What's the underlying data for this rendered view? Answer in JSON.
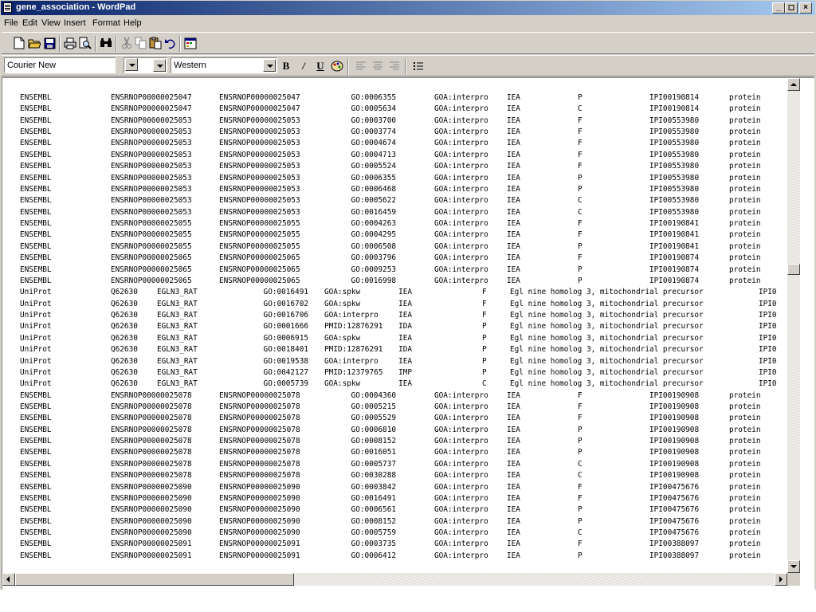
{
  "window": {
    "title": "gene_association - WordPad"
  },
  "menu": [
    "File",
    "Edit",
    "View",
    "Insert",
    "Format",
    "Help"
  ],
  "format_bar": {
    "font": "Courier New",
    "size": "8",
    "script": "Western"
  },
  "document": {
    "lines": [
      [
        "ENSEMBL",
        "ENSRNOP00000025047",
        "ENSRNOP00000025047",
        "GO:0006355",
        "GOA:interpro",
        "IEA",
        "P",
        "IPI00190814",
        "protein"
      ],
      [
        "ENSEMBL",
        "ENSRNOP00000025047",
        "ENSRNOP00000025047",
        "GO:0005634",
        "GOA:interpro",
        "IEA",
        "C",
        "IPI00190814",
        "protein"
      ],
      [
        "ENSEMBL",
        "ENSRNOP00000025053",
        "ENSRNOP00000025053",
        "GO:0003700",
        "GOA:interpro",
        "IEA",
        "F",
        "IPI00553980",
        "protein"
      ],
      [
        "ENSEMBL",
        "ENSRNOP00000025053",
        "ENSRNOP00000025053",
        "GO:0003774",
        "GOA:interpro",
        "IEA",
        "F",
        "IPI00553980",
        "protein"
      ],
      [
        "ENSEMBL",
        "ENSRNOP00000025053",
        "ENSRNOP00000025053",
        "GO:0004674",
        "GOA:interpro",
        "IEA",
        "F",
        "IPI00553980",
        "protein"
      ],
      [
        "ENSEMBL",
        "ENSRNOP00000025053",
        "ENSRNOP00000025053",
        "GO:0004713",
        "GOA:interpro",
        "IEA",
        "F",
        "IPI00553980",
        "protein"
      ],
      [
        "ENSEMBL",
        "ENSRNOP00000025053",
        "ENSRNOP00000025053",
        "GO:0005524",
        "GOA:interpro",
        "IEA",
        "F",
        "IPI00553980",
        "protein"
      ],
      [
        "ENSEMBL",
        "ENSRNOP00000025053",
        "ENSRNOP00000025053",
        "GO:0006355",
        "GOA:interpro",
        "IEA",
        "P",
        "IPI00553980",
        "protein"
      ],
      [
        "ENSEMBL",
        "ENSRNOP00000025053",
        "ENSRNOP00000025053",
        "GO:0006468",
        "GOA:interpro",
        "IEA",
        "P",
        "IPI00553980",
        "protein"
      ],
      [
        "ENSEMBL",
        "ENSRNOP00000025053",
        "ENSRNOP00000025053",
        "GO:0005622",
        "GOA:interpro",
        "IEA",
        "C",
        "IPI00553980",
        "protein"
      ],
      [
        "ENSEMBL",
        "ENSRNOP00000025053",
        "ENSRNOP00000025053",
        "GO:0016459",
        "GOA:interpro",
        "IEA",
        "C",
        "IPI00553980",
        "protein"
      ],
      [
        "ENSEMBL",
        "ENSRNOP00000025055",
        "ENSRNOP00000025055",
        "GO:0004263",
        "GOA:interpro",
        "IEA",
        "F",
        "IPI00190841",
        "protein"
      ],
      [
        "ENSEMBL",
        "ENSRNOP00000025055",
        "ENSRNOP00000025055",
        "GO:0004295",
        "GOA:interpro",
        "IEA",
        "F",
        "IPI00190841",
        "protein"
      ],
      [
        "ENSEMBL",
        "ENSRNOP00000025055",
        "ENSRNOP00000025055",
        "GO:0006508",
        "GOA:interpro",
        "IEA",
        "P",
        "IPI00190841",
        "protein"
      ],
      [
        "ENSEMBL",
        "ENSRNOP00000025065",
        "ENSRNOP00000025065",
        "GO:0003796",
        "GOA:interpro",
        "IEA",
        "F",
        "IPI00190874",
        "protein"
      ],
      [
        "ENSEMBL",
        "ENSRNOP00000025065",
        "ENSRNOP00000025065",
        "GO:0009253",
        "GOA:interpro",
        "IEA",
        "P",
        "IPI00190874",
        "protein"
      ],
      [
        "ENSEMBL",
        "ENSRNOP00000025065",
        "ENSRNOP00000025065",
        "GO:0016998",
        "GOA:interpro",
        "IEA",
        "P",
        "IPI00190874",
        "protein"
      ],
      [
        "UniProt",
        "Q62630",
        "EGLN3_RAT",
        "GO:0016491",
        "GOA:spkw",
        "IEA",
        "F",
        "Egl nine homolog 3, mitochondrial precursor",
        "IPI0"
      ],
      [
        "UniProt",
        "Q62630",
        "EGLN3_RAT",
        "GO:0016702",
        "GOA:spkw",
        "IEA",
        "F",
        "Egl nine homolog 3, mitochondrial precursor",
        "IPI0"
      ],
      [
        "UniProt",
        "Q62630",
        "EGLN3_RAT",
        "GO:0016706",
        "GOA:interpro",
        "IEA",
        "F",
        "Egl nine homolog 3, mitochondrial precursor",
        "IPI0"
      ],
      [
        "UniProt",
        "Q62630",
        "EGLN3_RAT",
        "GO:0001666",
        "PMID:12876291",
        "IDA",
        "P",
        "Egl nine homolog 3, mitochondrial precursor",
        "IPI0"
      ],
      [
        "UniProt",
        "Q62630",
        "EGLN3_RAT",
        "GO:0006915",
        "GOA:spkw",
        "IEA",
        "P",
        "Egl nine homolog 3, mitochondrial precursor",
        "IPI0"
      ],
      [
        "UniProt",
        "Q62630",
        "EGLN3_RAT",
        "GO:0018401",
        "PMID:12876291",
        "IDA",
        "P",
        "Egl nine homolog 3, mitochondrial precursor",
        "IPI0"
      ],
      [
        "UniProt",
        "Q62630",
        "EGLN3_RAT",
        "GO:0019538",
        "GOA:interpro",
        "IEA",
        "P",
        "Egl nine homolog 3, mitochondrial precursor",
        "IPI0"
      ],
      [
        "UniProt",
        "Q62630",
        "EGLN3_RAT",
        "GO:0042127",
        "PMID:12379765",
        "IMP",
        "P",
        "Egl nine homolog 3, mitochondrial precursor",
        "IPI0"
      ],
      [
        "UniProt",
        "Q62630",
        "EGLN3_RAT",
        "GO:0005739",
        "GOA:spkw",
        "IEA",
        "C",
        "Egl nine homolog 3, mitochondrial precursor",
        "IPI0"
      ],
      [
        "ENSEMBL",
        "ENSRNOP00000025078",
        "ENSRNOP00000025078",
        "GO:0004360",
        "GOA:interpro",
        "IEA",
        "F",
        "IPI00190908",
        "protein"
      ],
      [
        "ENSEMBL",
        "ENSRNOP00000025078",
        "ENSRNOP00000025078",
        "GO:0005215",
        "GOA:interpro",
        "IEA",
        "F",
        "IPI00190908",
        "protein"
      ],
      [
        "ENSEMBL",
        "ENSRNOP00000025078",
        "ENSRNOP00000025078",
        "GO:0005529",
        "GOA:interpro",
        "IEA",
        "F",
        "IPI00190908",
        "protein"
      ],
      [
        "ENSEMBL",
        "ENSRNOP00000025078",
        "ENSRNOP00000025078",
        "GO:0006810",
        "GOA:interpro",
        "IEA",
        "P",
        "IPI00190908",
        "protein"
      ],
      [
        "ENSEMBL",
        "ENSRNOP00000025078",
        "ENSRNOP00000025078",
        "GO:0008152",
        "GOA:interpro",
        "IEA",
        "P",
        "IPI00190908",
        "protein"
      ],
      [
        "ENSEMBL",
        "ENSRNOP00000025078",
        "ENSRNOP00000025078",
        "GO:0016051",
        "GOA:interpro",
        "IEA",
        "P",
        "IPI00190908",
        "protein"
      ],
      [
        "ENSEMBL",
        "ENSRNOP00000025078",
        "ENSRNOP00000025078",
        "GO:0005737",
        "GOA:interpro",
        "IEA",
        "C",
        "IPI00190908",
        "protein"
      ],
      [
        "ENSEMBL",
        "ENSRNOP00000025078",
        "ENSRNOP00000025078",
        "GO:0030288",
        "GOA:interpro",
        "IEA",
        "C",
        "IPI00190908",
        "protein"
      ],
      [
        "ENSEMBL",
        "ENSRNOP00000025090",
        "ENSRNOP00000025090",
        "GO:0003842",
        "GOA:interpro",
        "IEA",
        "F",
        "IPI00475676",
        "protein"
      ],
      [
        "ENSEMBL",
        "ENSRNOP00000025090",
        "ENSRNOP00000025090",
        "GO:0016491",
        "GOA:interpro",
        "IEA",
        "F",
        "IPI00475676",
        "protein"
      ],
      [
        "ENSEMBL",
        "ENSRNOP00000025090",
        "ENSRNOP00000025090",
        "GO:0006561",
        "GOA:interpro",
        "IEA",
        "P",
        "IPI00475676",
        "protein"
      ],
      [
        "ENSEMBL",
        "ENSRNOP00000025090",
        "ENSRNOP00000025090",
        "GO:0008152",
        "GOA:interpro",
        "IEA",
        "P",
        "IPI00475676",
        "protein"
      ],
      [
        "ENSEMBL",
        "ENSRNOP00000025090",
        "ENSRNOP00000025090",
        "GO:0005759",
        "GOA:interpro",
        "IEA",
        "C",
        "IPI00475676",
        "protein"
      ],
      [
        "ENSEMBL",
        "ENSRNOP00000025091",
        "ENSRNOP00000025091",
        "GO:0003735",
        "GOA:interpro",
        "IEA",
        "F",
        "IPI00388097",
        "protein"
      ],
      [
        "ENSEMBL",
        "ENSRNOP00000025091",
        "ENSRNOP00000025091",
        "GO:0006412",
        "GOA:interpro",
        "IEA",
        "P",
        "IPI00388097",
        "protein"
      ]
    ]
  }
}
